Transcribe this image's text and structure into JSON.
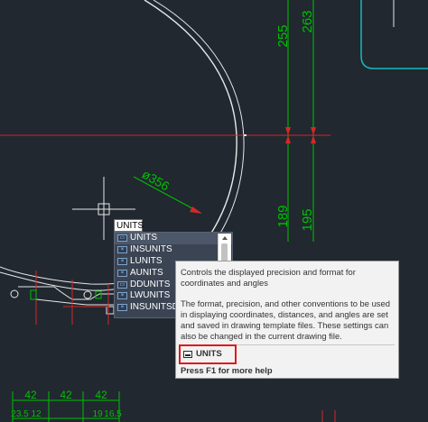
{
  "dimensions": {
    "d255": "255",
    "d263": "263",
    "d189": "189",
    "d195": "195",
    "d356": "ø356",
    "b1": "42",
    "b2": "42",
    "b3": "42",
    "b4": "23.5",
    "b5": "12",
    "b6": "19",
    "b7": "16.5"
  },
  "command_line": {
    "value": "UNITS"
  },
  "autocomplete": {
    "items": [
      {
        "label": "UNITS",
        "icon": "command-icon"
      },
      {
        "label": "INSUNITS",
        "icon": "variable-icon"
      },
      {
        "label": "LUNITS",
        "icon": "variable-icon"
      },
      {
        "label": "AUNITS",
        "icon": "variable-icon"
      },
      {
        "label": "DDUNITS",
        "icon": "command-icon"
      },
      {
        "label": "LWUNITS",
        "icon": "variable-icon"
      },
      {
        "label": "INSUNITSDEFSOURCE",
        "icon": "variable-icon"
      }
    ]
  },
  "tooltip": {
    "summary": "Controls the displayed precision and format for coordinates and angles",
    "detail": "The format, precision, and other conventions to be used in displaying coordinates, distances, and angles are set and saved in drawing template files. These settings can also be changed in the current drawing file.",
    "command": "UNITS",
    "help": "Press F1 for more help"
  },
  "colors": {
    "background": "#212830",
    "dimension": "#00c000",
    "centerline": "#d42828",
    "geometry": "#e8e8e8",
    "highlight_box": "#e0161b",
    "cyan_outline": "#18b9c0"
  }
}
